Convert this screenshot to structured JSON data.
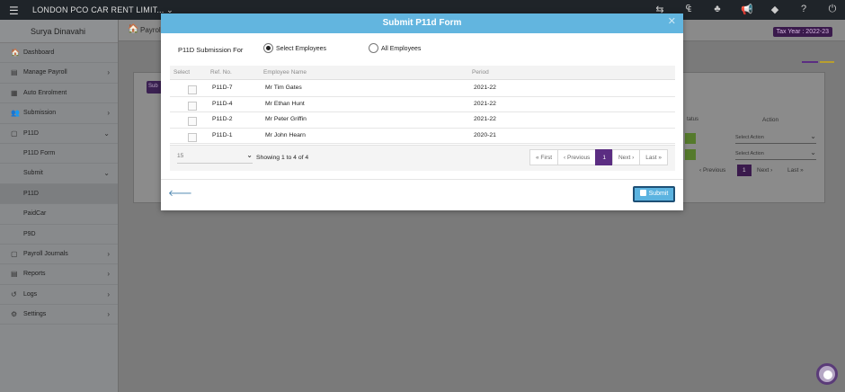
{
  "topbar": {
    "company": "LONDON PCO CAR RENT LIMIT...",
    "company_caret": "⌄",
    "menu_icon": "☰",
    "icons": [
      "⇆",
      "₠",
      "♣",
      "📢",
      "◆",
      "?",
      "⏻"
    ]
  },
  "sidebar": {
    "user": "Surya Dinavahi",
    "items": [
      {
        "label": "Dashboard",
        "icon": "🏠",
        "chevron": ""
      },
      {
        "label": "Manage Payroll",
        "icon": "▤",
        "chevron": "›"
      },
      {
        "label": "Auto Enrolment",
        "icon": "▦",
        "chevron": ""
      },
      {
        "label": "Submission",
        "icon": "👥",
        "chevron": "›"
      },
      {
        "label": "P11D",
        "icon": "▢",
        "chevron": "⌄"
      },
      {
        "label": "P11D Form",
        "icon": "",
        "chevron": ""
      },
      {
        "label": "Submit",
        "icon": "",
        "chevron": "⌄"
      },
      {
        "label": "P11D",
        "icon": "",
        "chevron": ""
      },
      {
        "label": "PaidCar",
        "icon": "",
        "chevron": ""
      },
      {
        "label": "P9D",
        "icon": "",
        "chevron": ""
      },
      {
        "label": "Payroll Journals",
        "icon": "▢",
        "chevron": "›"
      },
      {
        "label": "Reports",
        "icon": "▤",
        "chevron": "›"
      },
      {
        "label": "Logs",
        "icon": "↺",
        "chevron": "›"
      },
      {
        "label": "Settings",
        "icon": "⚙",
        "chevron": "›"
      }
    ]
  },
  "breadcrumb": {
    "home_icon": "🏠",
    "text": "Payrol"
  },
  "tax_year": "Tax Year : 2022-23",
  "background": {
    "btn_label": "Sub",
    "pager_prev": "‹ Previous",
    "pager_current": "1",
    "pager_next": "Next ›",
    "pager_last": "Last »",
    "select_action": "Select Action",
    "header_action": "Action",
    "header_status": "tatus"
  },
  "modal": {
    "title": "Submit P11d Form",
    "close_icon": "✕",
    "submission_for_label": "P11D Submission For",
    "options": [
      {
        "label": "Select Employees",
        "checked": true
      },
      {
        "label": "All Employees",
        "checked": false
      }
    ],
    "columns": [
      "Select",
      "Ref. No.",
      "Employee Name",
      "Period"
    ],
    "rows": [
      {
        "ref": "P11D-7",
        "name": "Mr Tim Gates",
        "period": "2021-22"
      },
      {
        "ref": "P11D-4",
        "name": "Mr Ethan Hunt",
        "period": "2021-22"
      },
      {
        "ref": "P11D-2",
        "name": "Mr Peter Griffin",
        "period": "2021-22"
      },
      {
        "ref": "P11D-1",
        "name": "Mr John Hearn",
        "period": "2020-21"
      }
    ],
    "page_size": "15",
    "showing": "Showing 1 to 4 of 4",
    "pager": {
      "first": "« First",
      "previous": "‹ Previous",
      "current": "1",
      "next": "Next ›",
      "last": "Last »"
    },
    "back_icon": "🡐",
    "submit_label": "Submit"
  },
  "colors": {
    "accent_purple": "#5b2d82",
    "header_blue": "#62b5df",
    "submit_border": "#1d4f75"
  }
}
